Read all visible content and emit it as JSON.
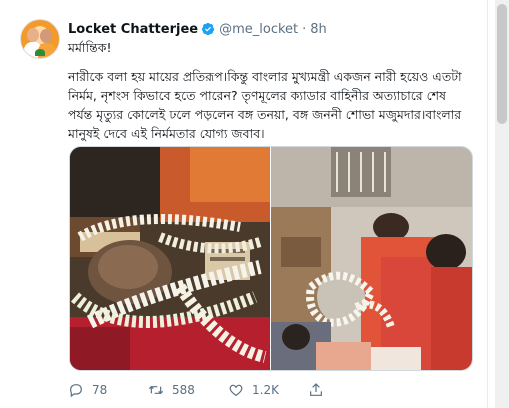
{
  "user": {
    "name": "Locket Chatterjee",
    "handle": "@me_locket",
    "separator": "·",
    "time": "8h"
  },
  "tweet": {
    "line1": "মর্মান্তিক!",
    "para_lines": [
      "নারীকে বলা হয় মায়ের প্রতিরূপ।কিন্তু বাংলার মুখ্যমন্ত্রী একজন নারী হয়েও এতটা",
      "নির্মম, নৃশংস কিভাবে হতে পারেন? তৃণমূলের ক্যাডার বাহিনীর অত্যাচারে শেষ",
      "পর্যন্ত মৃত্যুর কোলেই ঢলে পড়লেন বঙ্গ তনয়া, বঙ্গ জননী শোভা মজুমদার।বাংলার",
      "মানুষই দেবে এই নির্মমতার যোগ্য জবাব।"
    ]
  },
  "actions": {
    "replies": "78",
    "retweets": "588",
    "likes": "1.2K"
  },
  "colors": {
    "accent": "#1da1f2",
    "muted": "#5b7083"
  }
}
